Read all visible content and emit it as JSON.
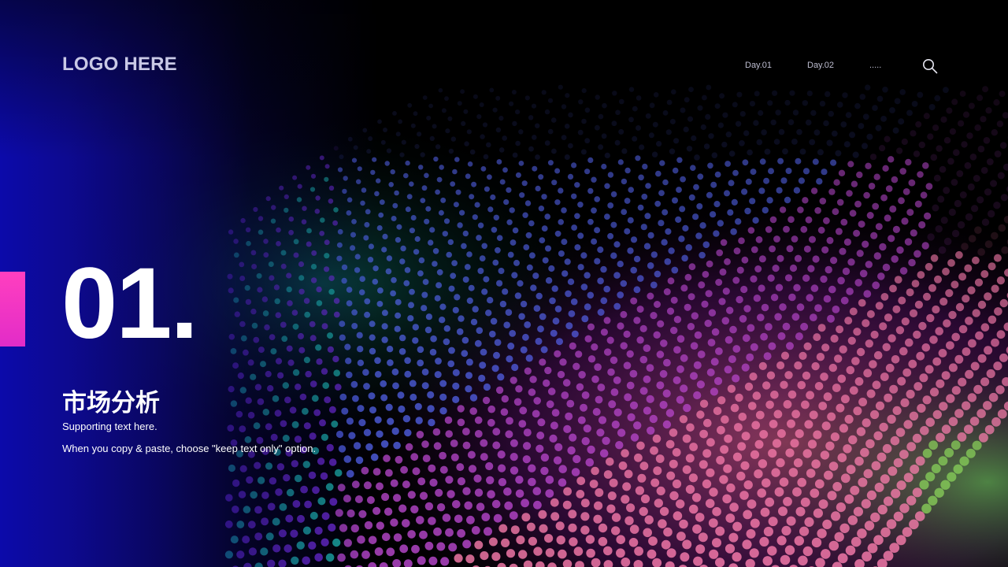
{
  "logo": {
    "text": "LOGO HERE"
  },
  "nav": {
    "items": [
      {
        "label": "Day.01"
      },
      {
        "label": "Day.02"
      },
      {
        "label": "....."
      }
    ],
    "search_icon": "search-icon"
  },
  "section": {
    "number": "01.",
    "title": "市场分析",
    "supporting_lines": [
      "Supporting  text here.",
      "When  you copy & paste, choose \"keep text only\" option."
    ]
  },
  "colors": {
    "left_gradient": "#0c0aaa",
    "accent_bar": "#ff3fbf",
    "text": "#ffffff",
    "logo": "#c9c9e6"
  }
}
